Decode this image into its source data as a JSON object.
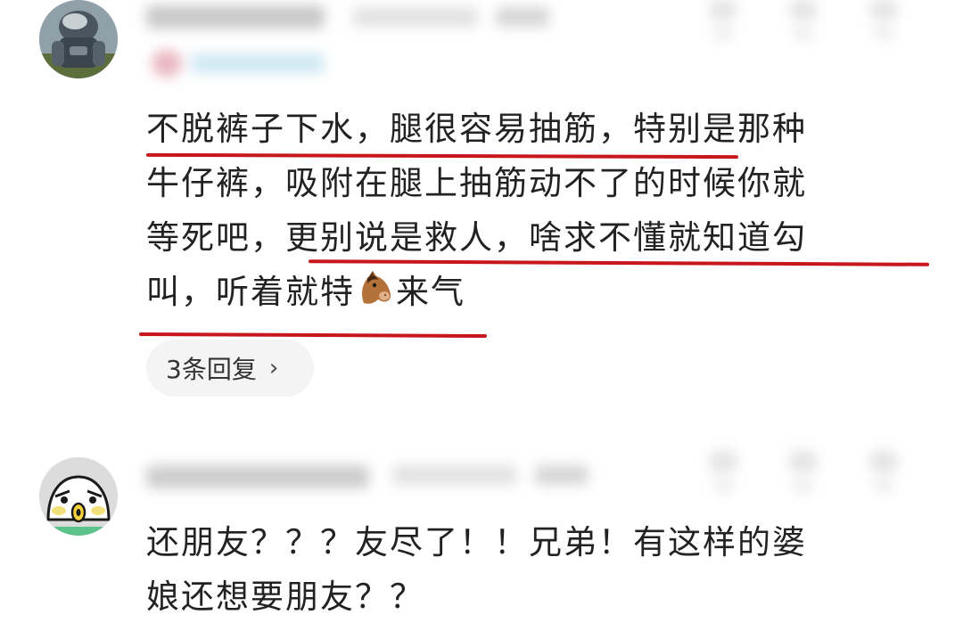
{
  "comments": [
    {
      "text_lines": [
        "不脱裤子下水，腿很容易抽筋，特别是那种",
        "牛仔裤，吸附在腿上抽筋动不了的时候你就",
        "等死吧，更别说是救人，啥求不懂就知道勾"
      ],
      "last_line_before_emoji": "叫，听着就特",
      "last_line_after_emoji": "来气",
      "emoji_icon": "horse-face-icon",
      "underline_color": "#c8161d",
      "replies_label": "3条回复",
      "replies_chevron": "›"
    },
    {
      "text_lines": [
        "还朋友？？？友尽了！！兄弟！有这样的婆",
        "娘还想要朋友？？"
      ]
    }
  ]
}
